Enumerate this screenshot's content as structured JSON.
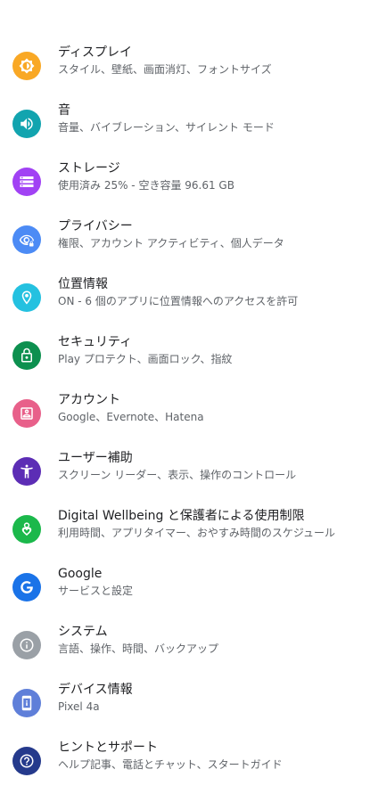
{
  "settings": {
    "items": [
      {
        "id": "display",
        "title": "ディスプレイ",
        "summary": "スタイル、壁紙、画面消灯、フォントサイズ",
        "icon": "brightness-icon",
        "color": "#F9A825"
      },
      {
        "id": "sound",
        "title": "音",
        "summary": "音量、バイブレーション、サイレント モード",
        "icon": "volume-icon",
        "color": "#12A4AF"
      },
      {
        "id": "storage",
        "title": "ストレージ",
        "summary": "使用済み 25% - 空き容量 96.61 GB",
        "icon": "storage-icon",
        "color": "#A142F4"
      },
      {
        "id": "privacy",
        "title": "プライバシー",
        "summary": "権限、アカウント アクティビティ、個人データ",
        "icon": "privacy-eye-icon",
        "color": "#4C8BF5"
      },
      {
        "id": "location",
        "title": "位置情報",
        "summary": "ON - 6 個のアプリに位置情報へのアクセスを許可",
        "icon": "location-pin-icon",
        "color": "#24C1E0"
      },
      {
        "id": "security",
        "title": "セキュリティ",
        "summary": "Play プロテクト、画面ロック、指紋",
        "icon": "lock-icon",
        "color": "#0D904F"
      },
      {
        "id": "accounts",
        "title": "アカウント",
        "summary": "Google、Evernote、Hatena",
        "icon": "account-box-icon",
        "color": "#E8608A"
      },
      {
        "id": "accessibility",
        "title": "ユーザー補助",
        "summary": "スクリーン リーダー、表示、操作のコントロール",
        "icon": "accessibility-icon",
        "color": "#5C2DB5"
      },
      {
        "id": "wellbeing",
        "title": "Digital Wellbeing と保護者による使用制限",
        "summary": "利用時間、アプリタイマー、おやすみ時間のスケジュール",
        "icon": "wellbeing-icon",
        "color": "#1BB84B"
      },
      {
        "id": "google",
        "title": "Google",
        "summary": "サービスと設定",
        "icon": "google-g-icon",
        "color": "#1A73E8"
      },
      {
        "id": "system",
        "title": "システム",
        "summary": "言語、操作、時間、バックアップ",
        "icon": "info-icon",
        "color": "#9AA0A6"
      },
      {
        "id": "about",
        "title": "デバイス情報",
        "summary": "Pixel 4a",
        "icon": "phone-info-icon",
        "color": "#5F7FD9"
      },
      {
        "id": "tips",
        "title": "ヒントとサポート",
        "summary": "ヘルプ記事、電話とチャット、スタートガイド",
        "icon": "help-icon",
        "color": "#253A8C"
      }
    ]
  }
}
